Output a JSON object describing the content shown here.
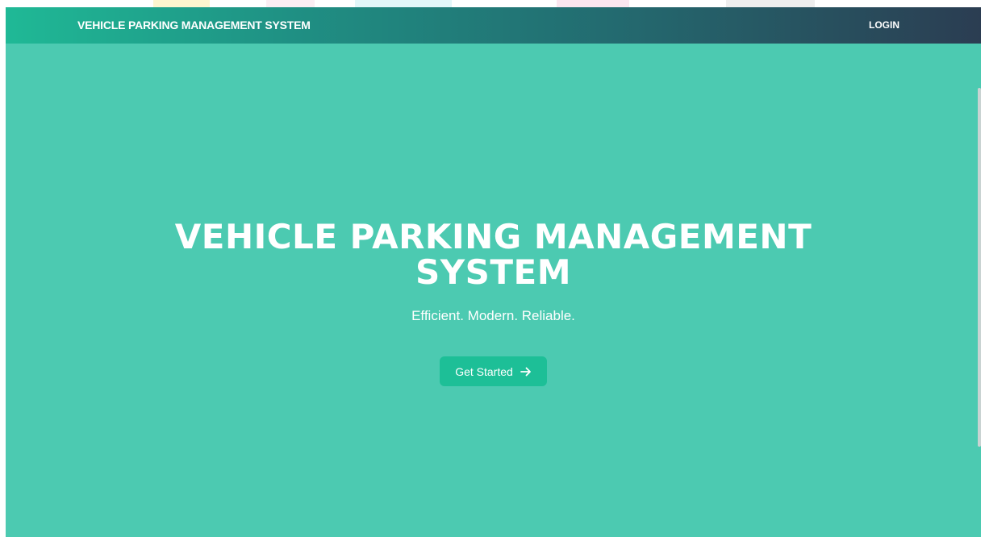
{
  "navbar": {
    "brand": "VEHICLE PARKING MANAGEMENT SYSTEM",
    "login_label": "LOGIN"
  },
  "hero": {
    "title": "VEHICLE PARKING MANAGEMENT SYSTEM",
    "subtitle": "Efficient. Modern. Reliable.",
    "cta_label": "Get Started",
    "cta_icon": "arrow-right-icon"
  },
  "colors": {
    "hero_background": "#4ccab1",
    "navbar_start": "#1fb996",
    "navbar_end": "#2b3d52",
    "button_background": "#1dbf97",
    "text": "#ffffff"
  }
}
